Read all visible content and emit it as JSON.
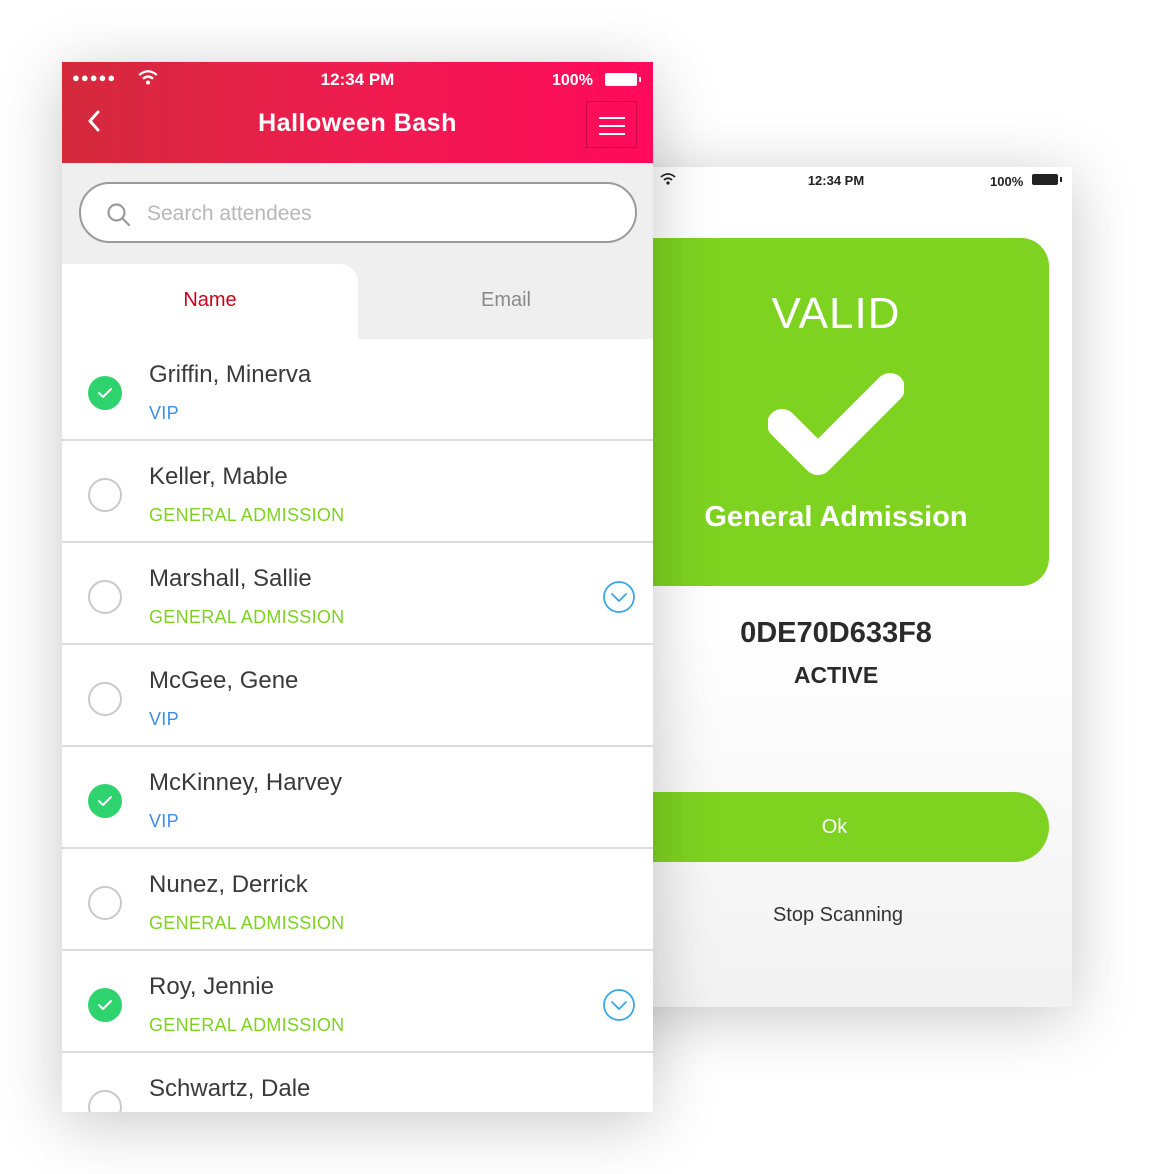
{
  "scan_screen": {
    "status": {
      "time": "12:34 PM",
      "battery": "100%"
    },
    "result": "VALID",
    "ticket_type": "General Admission",
    "ticket_code": "0DE70D633F8",
    "ticket_status": "ACTIVE",
    "ok_label": "Ok",
    "stop_label": "Stop Scanning",
    "colors": {
      "success": "#7ed321"
    }
  },
  "list_screen": {
    "status": {
      "signal": "●●●●●",
      "time": "12:34 PM",
      "battery": "100%"
    },
    "title": "Halloween Bash",
    "search": {
      "placeholder": "Search attendees"
    },
    "tabs": [
      {
        "label": "Name"
      },
      {
        "label": "Email"
      }
    ],
    "attendees": [
      {
        "name": "Griffin, Minerva",
        "type": "VIP"
      },
      {
        "name": "Keller, Mable",
        "type": "GENERAL ADMISSION"
      },
      {
        "name": "Marshall, Sallie",
        "type": "GENERAL ADMISSION"
      },
      {
        "name": "McGee, Gene",
        "type": "VIP"
      },
      {
        "name": "McKinney, Harvey",
        "type": "VIP"
      },
      {
        "name": "Nunez, Derrick",
        "type": "GENERAL ADMISSION"
      },
      {
        "name": "Roy, Jennie",
        "type": "GENERAL ADMISSION"
      },
      {
        "name": "Schwartz, Dale",
        "type": ""
      }
    ],
    "colors": {
      "header": "#ee1c4f",
      "checked": "#2fd36e",
      "vip": "#3b8fe8",
      "general": "#7ed321",
      "active_tab": "#d0021b"
    }
  }
}
